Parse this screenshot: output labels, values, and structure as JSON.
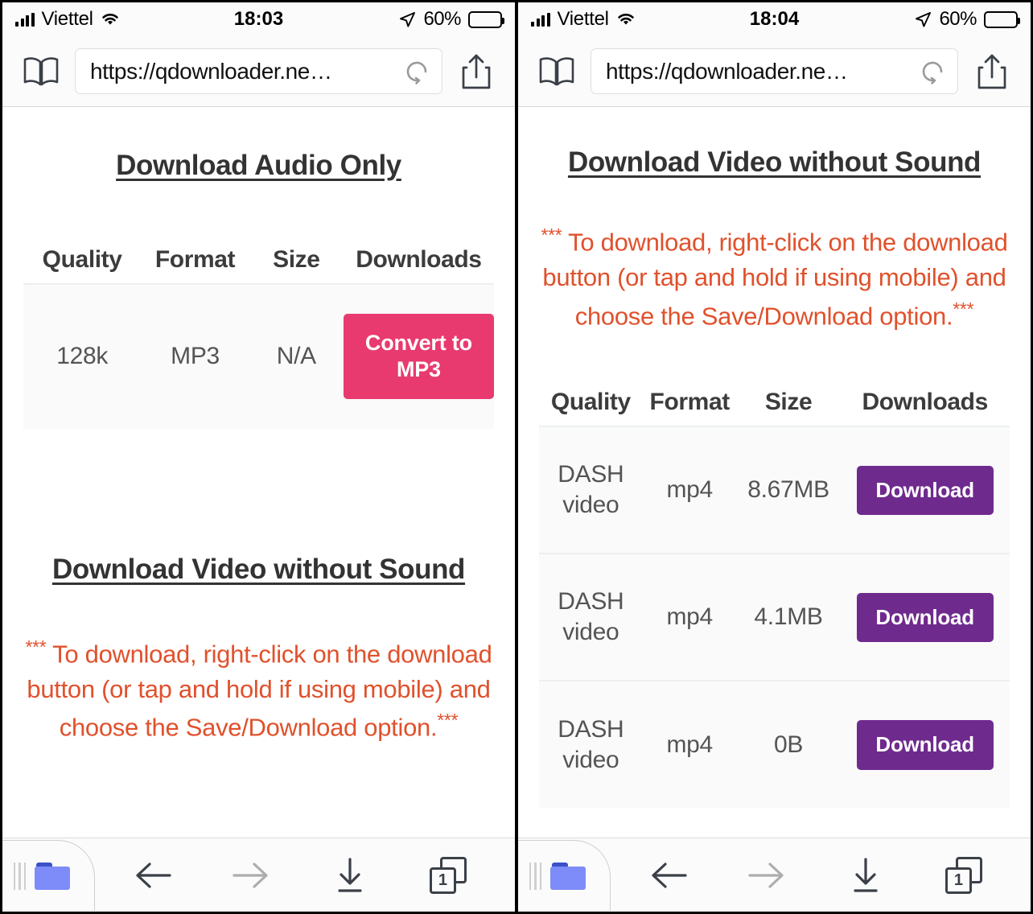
{
  "panels": [
    {
      "id": "left",
      "status": {
        "carrier": "Viettel",
        "time": "18:03",
        "battery_percent": "60%",
        "battery_level": 60,
        "signal_icon": "cellular-bars-icon",
        "wifi_icon": "wifi-icon",
        "location_icon": "location-arrow-icon"
      },
      "browser": {
        "bookmarks_icon": "book-icon",
        "url": "https://qdownloader.ne…",
        "reload_icon": "reload-icon",
        "share_icon": "share-icon"
      },
      "sections": [
        {
          "type": "table_section",
          "title": "Download Audio Only",
          "headers": [
            "Quality",
            "Format",
            "Size",
            "Downloads"
          ],
          "rows": [
            {
              "quality": "128k",
              "format": "MP3",
              "size": "N/A",
              "action": "Convert to MP3",
              "action_style": "pink"
            }
          ]
        },
        {
          "type": "notice_section",
          "title": "Download Video without Sound",
          "notice_prefix": "***",
          "notice_text": " To download, right-click on the download button (or tap and hold if using mobile) and choose the Save/Download option.",
          "notice_suffix": "***"
        }
      ],
      "toolbar": {
        "folder_icon": "folder-icon",
        "grip_icon": "drag-handle-icon",
        "back_icon": "arrow-left-icon",
        "forward_icon": "arrow-right-icon",
        "download_icon": "download-arrow-icon",
        "tabs_icon": "tabs-stack-icon",
        "tab_count": "1"
      }
    },
    {
      "id": "right",
      "status": {
        "carrier": "Viettel",
        "time": "18:04",
        "battery_percent": "60%",
        "battery_level": 60,
        "signal_icon": "cellular-bars-icon",
        "wifi_icon": "wifi-icon",
        "location_icon": "location-arrow-icon"
      },
      "browser": {
        "bookmarks_icon": "book-icon",
        "url": "https://qdownloader.ne…",
        "reload_icon": "reload-icon",
        "share_icon": "share-icon"
      },
      "sections": [
        {
          "type": "video_section",
          "title": "Download Video without Sound",
          "notice_prefix": "***",
          "notice_text": " To download, right-click on the download button (or tap and hold if using mobile) and choose the Save/Download option.",
          "notice_suffix": "***",
          "headers": [
            "Quality",
            "Format",
            "Size",
            "Downloads"
          ],
          "rows": [
            {
              "quality": "DASH video",
              "format": "mp4",
              "size": "8.67MB",
              "action": "Download",
              "action_style": "purple"
            },
            {
              "quality": "DASH video",
              "format": "mp4",
              "size": "4.1MB",
              "action": "Download",
              "action_style": "purple"
            },
            {
              "quality": "DASH video",
              "format": "mp4",
              "size": "0B",
              "action": "Download",
              "action_style": "purple"
            }
          ]
        }
      ],
      "toolbar": {
        "folder_icon": "folder-icon",
        "grip_icon": "drag-handle-icon",
        "back_icon": "arrow-left-icon",
        "forward_icon": "arrow-right-icon",
        "download_icon": "download-arrow-icon",
        "tabs_icon": "tabs-stack-icon",
        "tab_count": "1"
      }
    }
  ],
  "colors": {
    "pink_button": "#e93a70",
    "purple_button": "#6f2a8e",
    "notice_text": "#e0512c",
    "heading": "#333333",
    "row_background": "#fafafa"
  }
}
